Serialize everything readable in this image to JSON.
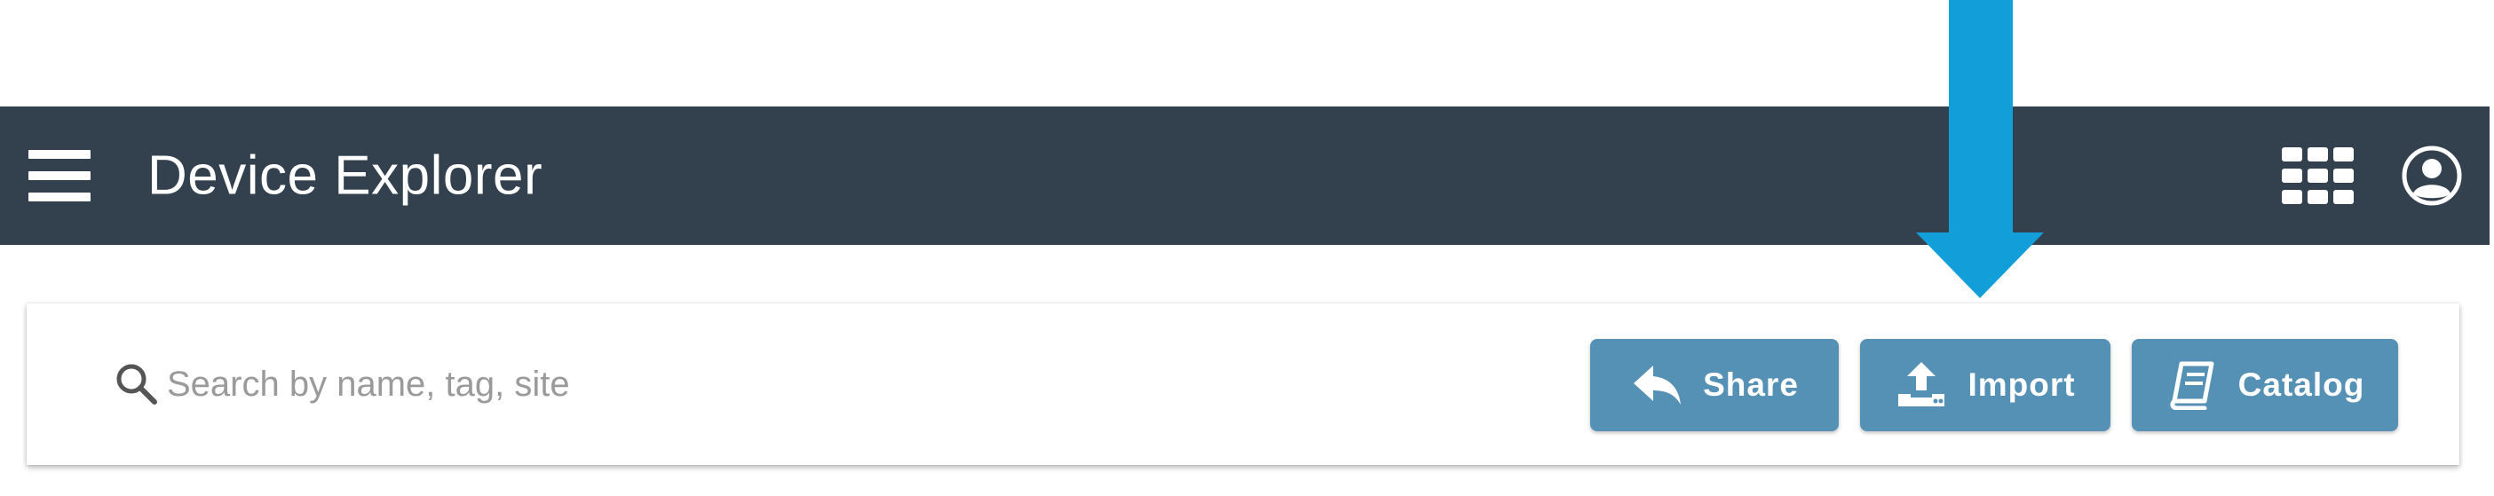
{
  "appbar": {
    "title": "Device Explorer",
    "menu_icon": "hamburger-menu-icon",
    "apps_icon": "apps-grid-icon",
    "user_icon": "account-circle-icon",
    "background_color": "#33404e"
  },
  "search": {
    "placeholder": "Search by name, tag, site",
    "value": "",
    "icon": "search-icon"
  },
  "actions": {
    "share": {
      "label": "Share",
      "icon": "reply-arrow-icon"
    },
    "import": {
      "label": "Import",
      "icon": "upload-icon"
    },
    "catalog": {
      "label": "Catalog",
      "icon": "book-icon"
    },
    "button_color": "#5591b5"
  },
  "annotation": {
    "arrow_color": "#129fd9",
    "points_to": "import"
  }
}
